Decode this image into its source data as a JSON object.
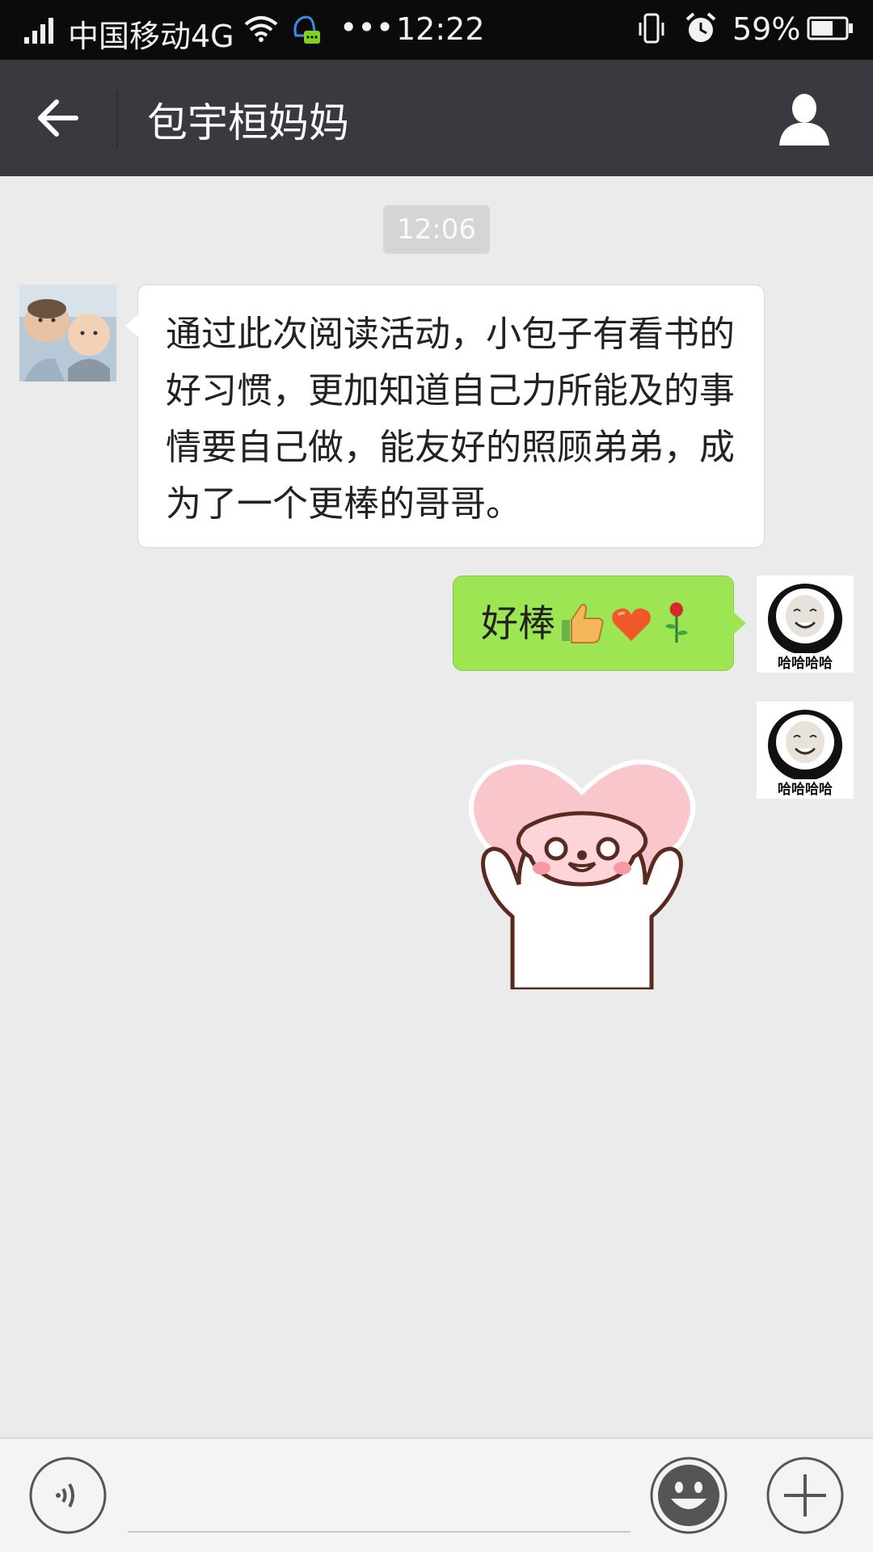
{
  "status_bar": {
    "carrier": "中国移动4G",
    "dots": "•••",
    "time": "12:22",
    "battery": "59%"
  },
  "header": {
    "title": "包宇桓妈妈"
  },
  "chat": {
    "timestamp": "12:06",
    "messages": [
      {
        "side": "left",
        "text": "通过此次阅读活动，小包子有看书的好习惯，更加知道自己力所能及的事情要自己做，能友好的照顾弟弟，成为了一个更棒的哥哥。"
      },
      {
        "side": "right",
        "text": "好棒",
        "emojis": [
          "👍",
          "❤",
          "🌹"
        ]
      },
      {
        "side": "right",
        "type": "sticker",
        "sticker": "pink-bunny-heart-sticker"
      }
    ],
    "avatar_caption": "哈哈哈哈"
  },
  "colors": {
    "title_bar": "#393a3f",
    "bubble_right": "#9ee553",
    "chat_bg": "#ebebeb"
  }
}
